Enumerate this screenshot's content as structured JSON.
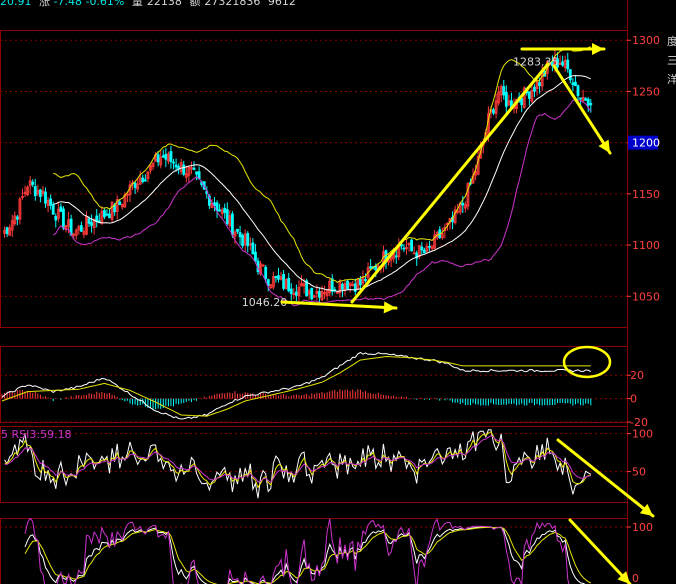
{
  "header": {
    "close_partial": "20.91",
    "change_label": "涨",
    "change_value": "-7.48",
    "change_pct": "-0.61%",
    "volume_label": "量",
    "volume_value": "22138",
    "amount_label": "额",
    "amount_value": "27321836",
    "extra_value": "9612"
  },
  "rsi_label": "5  RSI3:59.18",
  "right_edge_chars": [
    "度",
    "三",
    "洋"
  ],
  "colors": {
    "up": "#ff3b3b",
    "down": "#00ffff",
    "grid": "#8b0000",
    "frame": "#8b0000",
    "boll_upper": "#e6e600",
    "boll_mid": "#ffffff",
    "boll_lower": "#cc33cc",
    "annotation": "#ffff00",
    "axis_text": "#ff4040",
    "price_tag_bg": "#0000cc"
  },
  "chart_data": [
    {
      "type": "candlestick",
      "panel": "price",
      "ylim": [
        1020,
        1310
      ],
      "y_ticks": [
        1050,
        1100,
        1150,
        1200,
        1250,
        1300
      ],
      "current_price_tag": "1200",
      "annotations": {
        "high_label": "1283.35",
        "low_label": "1046.20"
      },
      "overlays": [
        "BOLL upper",
        "BOLL mid",
        "BOLL lower"
      ],
      "close_path": [
        [
          0,
          1110
        ],
        [
          6,
          1132
        ],
        [
          10,
          1160
        ],
        [
          16,
          1150
        ],
        [
          22,
          1128
        ],
        [
          28,
          1112
        ],
        [
          34,
          1122
        ],
        [
          40,
          1130
        ],
        [
          46,
          1140
        ],
        [
          52,
          1162
        ],
        [
          58,
          1175
        ],
        [
          62,
          1187
        ],
        [
          68,
          1180
        ],
        [
          74,
          1170
        ],
        [
          78,
          1155
        ],
        [
          84,
          1138
        ],
        [
          90,
          1118
        ],
        [
          96,
          1100
        ],
        [
          100,
          1080
        ],
        [
          104,
          1068
        ],
        [
          110,
          1062
        ],
        [
          116,
          1058
        ],
        [
          122,
          1054
        ],
        [
          128,
          1060
        ],
        [
          134,
          1064
        ],
        [
          140,
          1062
        ],
        [
          144,
          1074
        ],
        [
          150,
          1090
        ],
        [
          156,
          1100
        ],
        [
          160,
          1094
        ],
        [
          166,
          1092
        ],
        [
          170,
          1106
        ],
        [
          176,
          1122
        ],
        [
          180,
          1140
        ],
        [
          184,
          1165
        ],
        [
          188,
          1200
        ],
        [
          190,
          1222
        ],
        [
          194,
          1250
        ],
        [
          198,
          1238
        ],
        [
          204,
          1246
        ],
        [
          210,
          1260
        ],
        [
          214,
          1276
        ],
        [
          218,
          1280
        ],
        [
          222,
          1268
        ],
        [
          226,
          1244
        ]
      ]
    },
    {
      "type": "macd",
      "panel": "macd",
      "ylim": [
        -20,
        45
      ],
      "y_ticks": [
        20,
        0,
        -20
      ],
      "dif_path": [
        [
          0,
          2
        ],
        [
          10,
          12
        ],
        [
          20,
          6
        ],
        [
          30,
          10
        ],
        [
          40,
          18
        ],
        [
          50,
          4
        ],
        [
          60,
          -10
        ],
        [
          70,
          -18
        ],
        [
          80,
          -14
        ],
        [
          88,
          -4
        ],
        [
          95,
          2
        ],
        [
          105,
          6
        ],
        [
          115,
          10
        ],
        [
          125,
          18
        ],
        [
          132,
          28
        ],
        [
          140,
          39
        ],
        [
          150,
          38
        ],
        [
          160,
          35
        ],
        [
          168,
          33
        ],
        [
          174,
          30
        ],
        [
          180,
          24
        ]
      ],
      "dea_path": [
        [
          0,
          -2
        ],
        [
          10,
          6
        ],
        [
          20,
          7
        ],
        [
          30,
          8
        ],
        [
          40,
          13
        ],
        [
          50,
          7
        ],
        [
          60,
          -3
        ],
        [
          70,
          -14
        ],
        [
          80,
          -15
        ],
        [
          88,
          -9
        ],
        [
          95,
          -2
        ],
        [
          105,
          3
        ],
        [
          115,
          8
        ],
        [
          125,
          14
        ],
        [
          132,
          22
        ],
        [
          140,
          33
        ],
        [
          150,
          36
        ],
        [
          160,
          35
        ],
        [
          168,
          33
        ],
        [
          174,
          31
        ],
        [
          180,
          28
        ]
      ]
    },
    {
      "type": "line",
      "panel": "rsi",
      "ylim": [
        10,
        110
      ],
      "y_ticks": [
        100,
        50
      ],
      "series": [
        {
          "name": "RSI3",
          "values": [
            59.18
          ]
        }
      ]
    },
    {
      "type": "line",
      "panel": "kdj",
      "ylim": [
        -5,
        115
      ],
      "y_ticks": [
        100,
        0
      ]
    }
  ]
}
